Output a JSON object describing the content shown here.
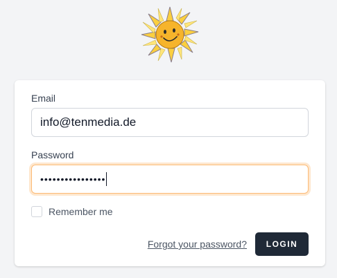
{
  "logo": {
    "icon": "sun-logo-icon"
  },
  "form": {
    "email_label": "Email",
    "email_value": "info@tenmedia.de",
    "password_label": "Password",
    "password_value": "••••••••••••••••",
    "remember_label": "Remember me",
    "remember_checked": false,
    "forgot_link": "Forgot your password?",
    "login_button": "LOGIN"
  },
  "colors": {
    "background": "#f3f4f6",
    "card": "#ffffff",
    "button": "#1f2937",
    "focus_ring": "#fdba74",
    "sun_yellow": "#f6b42b"
  }
}
